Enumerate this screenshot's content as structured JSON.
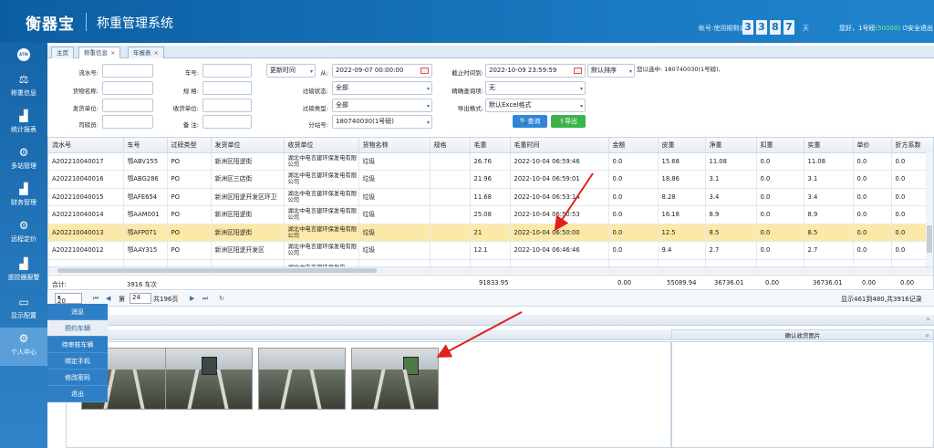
{
  "header": {
    "logo": "衡器宝",
    "title": "称重管理系统",
    "days_label": "帐号:使用期剩余",
    "days_digits": [
      "3",
      "3",
      "8",
      "7"
    ],
    "days_unit": "天",
    "user_text": "您好，1号磅",
    "user_account": "(50000)",
    "logout": "安全退出"
  },
  "sidebar": {
    "avatar": "ATW",
    "items": [
      {
        "label": "称重信息",
        "icon": "scale-icon"
      },
      {
        "label": "统计报表",
        "icon": "chart-icon"
      },
      {
        "label": "多站管理",
        "icon": "gear-icon"
      },
      {
        "label": "财务管理",
        "icon": "finance-icon"
      },
      {
        "label": "远程定价",
        "icon": "gear-icon"
      },
      {
        "label": "遥控器报警",
        "icon": "chart-icon"
      },
      {
        "label": "显示配置",
        "icon": "monitor-icon"
      },
      {
        "label": "个人中心",
        "icon": "gear-icon"
      }
    ],
    "submenu": [
      "消息",
      "预约车辆",
      "待审核车辆",
      "绑定手机",
      "修改密码",
      "退出"
    ]
  },
  "tabs": [
    {
      "label": "主页"
    },
    {
      "label": "称重信息"
    },
    {
      "label": "年报表"
    }
  ],
  "filters": {
    "serial_label": "流水号:",
    "goods_label": "货物名称:",
    "sender_label": "发货单位:",
    "driver_label": "司磅员:",
    "plate_label": "车号:",
    "spec_label": "规  格:",
    "receiver_label": "收货单位:",
    "note_label": "备  注:",
    "time_type": "更新时间",
    "from_label": "从:",
    "from_value": "2022-09-07 00:00:00",
    "to_label": "截止时间到:",
    "to_value": "2022-10-09 23:59:59",
    "sort_value": "默认排序",
    "selected_info": "您以选中: 180740030(1号磅),",
    "status_label": "过磅状态:",
    "status_value": "全部",
    "exact_label": "精确查询项:",
    "exact_value": "无",
    "type_label": "过磅类型:",
    "type_value": "全部",
    "export_label": "导出格式:",
    "export_value": "默认Excel格式",
    "station_label": "分站号:",
    "station_value": "180740030(1号磅)",
    "search_btn": "查询",
    "export_btn": "导出"
  },
  "grid": {
    "columns": [
      "流水号",
      "车号",
      "过磅类型",
      "发货单位",
      "收货单位",
      "货物名称",
      "规格",
      "毛重",
      "毛重时间",
      "金额",
      "皮重",
      "净重",
      "扣重",
      "实重",
      "单价",
      "折方系数"
    ],
    "rows": [
      [
        "A202210040017",
        "鄂ABV155",
        "PO",
        "新洲区阳逻街",
        "湖北中电言建环保发电有限公司",
        "垃圾",
        "",
        "26.76",
        "2022-10-04 06:59:46",
        "0.0",
        "15.68",
        "11.08",
        "0.0",
        "11.08",
        "0.0",
        "0.0"
      ],
      [
        "A202210040016",
        "鄂ABG286",
        "PO",
        "新洲区三店街",
        "湖北中电言建环保发电有限公司",
        "垃圾",
        "",
        "21.96",
        "2022-10-04 06:59:01",
        "0.0",
        "18.86",
        "3.1",
        "0.0",
        "3.1",
        "0.0",
        "0.0"
      ],
      [
        "A202210040015",
        "鄂AFE654",
        "PO",
        "新洲区阳逻开发区环卫",
        "湖北中电言建环保发电有限公司",
        "垃圾",
        "",
        "11.68",
        "2022-10-04 06:53:14",
        "0.0",
        "8.28",
        "3.4",
        "0.0",
        "3.4",
        "0.0",
        "0.0"
      ],
      [
        "A202210040014",
        "鄂AAM001",
        "PO",
        "新洲区阳逻街",
        "湖北中电言建环保发电有限公司",
        "垃圾",
        "",
        "25.08",
        "2022-10-04 06:50:53",
        "0.0",
        "16.18",
        "8.9",
        "0.0",
        "8.9",
        "0.0",
        "0.0"
      ],
      [
        "A202210040013",
        "鄂AFP071",
        "PO",
        "新洲区阳逻街",
        "湖北中电言建环保发电有限公司",
        "垃圾",
        "",
        "21",
        "2022-10-04 06:50:00",
        "0.0",
        "12.5",
        "8.5",
        "0.0",
        "8.5",
        "0.0",
        "0.0"
      ],
      [
        "A202210040012",
        "鄂AAY315",
        "PO",
        "新洲区阳逻开发区",
        "湖北中电言建环保发电有限公司",
        "垃圾",
        "",
        "12.1",
        "2022-10-04 06:46:46",
        "0.0",
        "9.4",
        "2.7",
        "0.0",
        "2.7",
        "0.0",
        "0.0"
      ],
      [
        "",
        "",
        "",
        "",
        "湖北中电言建环保发电",
        "",
        "",
        "",
        "",
        "",
        "",
        "",
        "",
        "",
        "",
        ""
      ]
    ],
    "summary": {
      "label": "合计:",
      "count": "3916 车次",
      "gross": "91833.95",
      "amount": "0.00",
      "tare": "55089.94",
      "net": "36736.01",
      "deduct": "0.00",
      "real": "36736.01",
      "price": "0.00",
      "factor": "0.00"
    }
  },
  "pager": {
    "page_size": "20",
    "page_label": "第",
    "page_value": "24",
    "total_pages": "共196页",
    "info": "显示461到480,共3916记录"
  },
  "bottom": {
    "right_title": "确认收货图片"
  }
}
